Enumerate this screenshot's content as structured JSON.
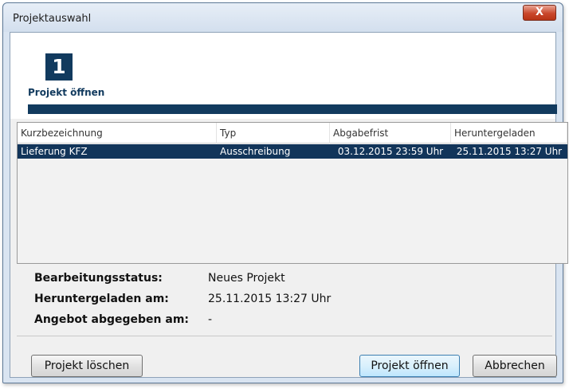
{
  "window": {
    "title": "Projektauswahl",
    "close_glyph": "X"
  },
  "step": {
    "number": "1",
    "label": "Projekt öffnen",
    "accent_color": "#113a5e"
  },
  "table": {
    "columns": [
      "Kurzbezeichnung",
      "Typ",
      "Abgabefrist",
      "Heruntergeladen"
    ],
    "rows": [
      {
        "kurzbezeichnung": "Lieferung KFZ",
        "typ": "Ausschreibung",
        "abgabefrist": "03.12.2015 23:59 Uhr",
        "heruntergeladen": "25.11.2015 13:27 Uhr",
        "selected": true
      }
    ]
  },
  "details": {
    "status_label": "Bearbeitungsstatus:",
    "status_value": "Neues Projekt",
    "downloaded_label": "Heruntergeladen am:",
    "downloaded_value": "25.11.2015 13:27 Uhr",
    "submitted_label": "Angebot abgegeben am:",
    "submitted_value": "-"
  },
  "buttons": {
    "delete": "Projekt löschen",
    "open": "Projekt öffnen",
    "cancel": "Abbrechen"
  }
}
